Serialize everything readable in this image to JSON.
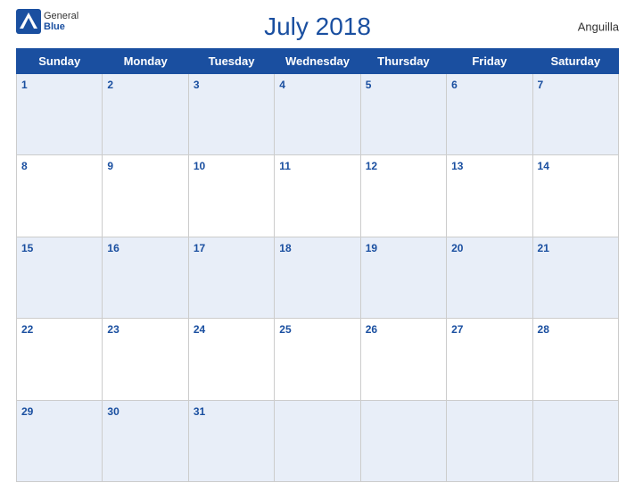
{
  "header": {
    "title": "July 2018",
    "region": "Anguilla",
    "logo_general": "General",
    "logo_blue": "Blue"
  },
  "weekdays": [
    "Sunday",
    "Monday",
    "Tuesday",
    "Wednesday",
    "Thursday",
    "Friday",
    "Saturday"
  ],
  "weeks": [
    [
      {
        "day": 1
      },
      {
        "day": 2
      },
      {
        "day": 3
      },
      {
        "day": 4
      },
      {
        "day": 5
      },
      {
        "day": 6
      },
      {
        "day": 7
      }
    ],
    [
      {
        "day": 8
      },
      {
        "day": 9
      },
      {
        "day": 10
      },
      {
        "day": 11
      },
      {
        "day": 12
      },
      {
        "day": 13
      },
      {
        "day": 14
      }
    ],
    [
      {
        "day": 15
      },
      {
        "day": 16
      },
      {
        "day": 17
      },
      {
        "day": 18
      },
      {
        "day": 19
      },
      {
        "day": 20
      },
      {
        "day": 21
      }
    ],
    [
      {
        "day": 22
      },
      {
        "day": 23
      },
      {
        "day": 24
      },
      {
        "day": 25
      },
      {
        "day": 26
      },
      {
        "day": 27
      },
      {
        "day": 28
      }
    ],
    [
      {
        "day": 29
      },
      {
        "day": 30
      },
      {
        "day": 31
      },
      {
        "day": null
      },
      {
        "day": null
      },
      {
        "day": null
      },
      {
        "day": null
      }
    ]
  ]
}
